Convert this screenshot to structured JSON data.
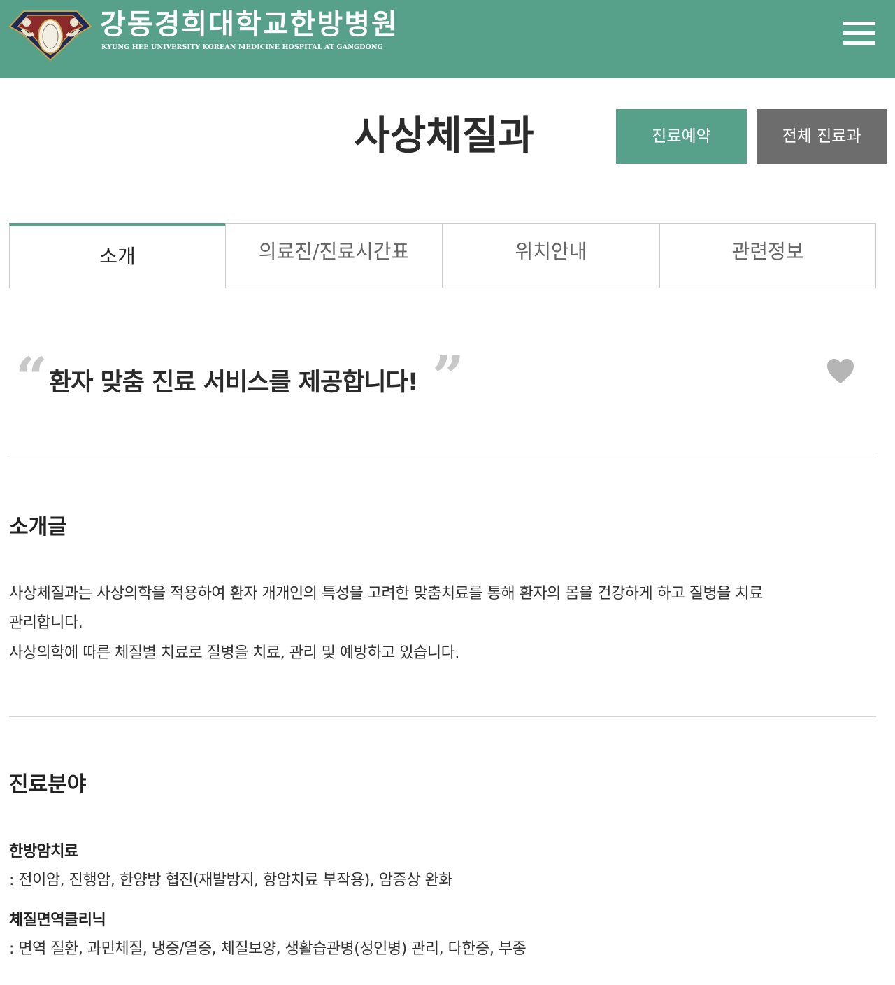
{
  "header": {
    "logo_title": "강동경희대학교한방병원",
    "logo_subtitle": "KYUNG HEE UNIVERSITY KOREAN MEDICINE HOSPITAL AT GANGDONG",
    "menu_icon": "hamburger-menu-icon",
    "logo_icon": "hospital-emblem-icon"
  },
  "page": {
    "title": "사상체질과",
    "reserve_button": "진료예약",
    "all_departments_button": "전체 진료과"
  },
  "tabs": [
    {
      "label": "소개",
      "active": true
    },
    {
      "label": "의료진/진료시간표",
      "active": false
    },
    {
      "label": "위치안내",
      "active": false
    },
    {
      "label": "관련정보",
      "active": false
    }
  ],
  "slogan": {
    "text": "환자 맞춤 진료 서비스를 제공합니다!",
    "open_quote": "“",
    "close_quote": "”",
    "favorite_icon": "heart-icon"
  },
  "intro": {
    "heading": "소개글",
    "lines": [
      "사상체질과는 사상의학을 적용하여 환자 개개인의 특성을 고려한 맞춤치료를 통해 환자의 몸을 건강하게 하고 질병을 치료",
      "관리합니다.",
      "사상의학에 따른 체질별 치료로 질병을 치료, 관리 및 예방하고 있습니다."
    ]
  },
  "fields": {
    "heading": "진료분야",
    "items": [
      {
        "title": "한방암치료",
        "desc": ": 전이암, 진행암, 한양방 협진(재발방지, 항암치료 부작용), 암증상 완화"
      },
      {
        "title": "체질면역클리닉",
        "desc": ": 면역 질환, 과민체질, 냉증/열증, 체질보양, 생활습관병(성인병) 관리, 다한증, 부종"
      }
    ]
  },
  "colors": {
    "brand_green": "#57a08a",
    "button_gray": "#6d6d6d",
    "quote_gray": "#c8c8c8",
    "heart_gray": "#b5b5b5"
  }
}
